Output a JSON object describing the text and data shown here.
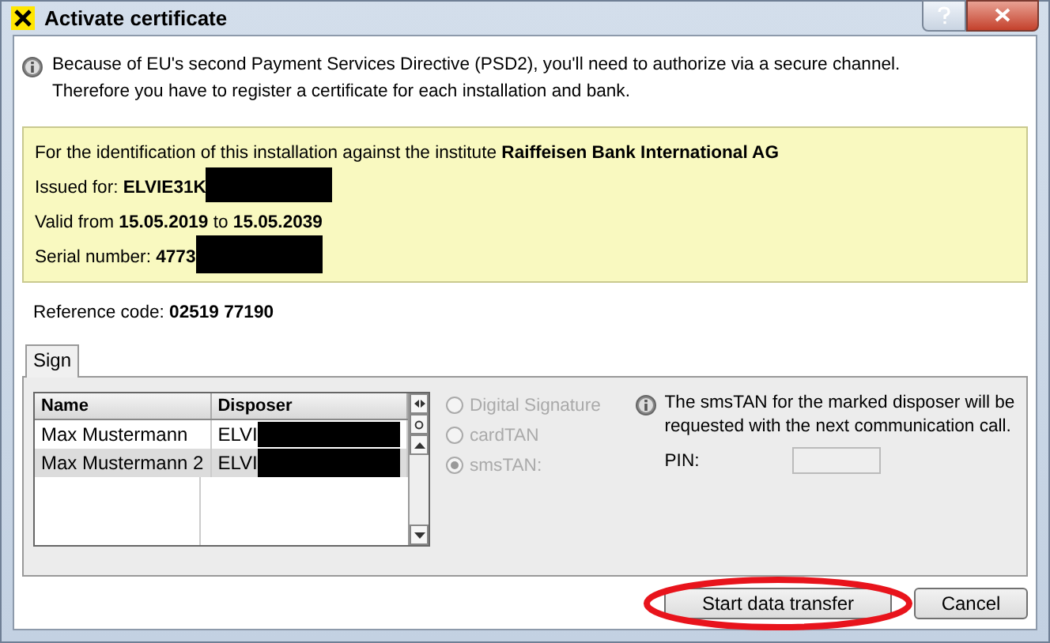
{
  "window": {
    "title": "Activate certificate"
  },
  "intro_lines": [
    "Because of EU's second Payment Services Directive (PSD2), you'll need to authorize via a secure channel.",
    "Therefore you have to register a certificate for each installation and bank."
  ],
  "certificate": [
    {
      "text": "For the identification of this installation against the institute **Raiffeisen Bank International AG**",
      "redacted": false
    },
    {
      "text": "Issued for: **ELVIE31K**",
      "redacted": true
    },
    {
      "text": "Valid from **15.05.2019** to **15.05.2039**",
      "redacted": false
    },
    {
      "text": "Serial number: **4773**",
      "redacted": true
    }
  ],
  "reference": "Reference code: **02519 77190**",
  "tabs": [
    {
      "label": "Sign",
      "selected": true
    }
  ],
  "table": {
    "columns": [
      "Name",
      "Disposer"
    ],
    "rows": [
      {
        "name": "Max Mustermann",
        "disposer": "ELVI",
        "redacted": true,
        "selected": false
      },
      {
        "name": "Max Mustermann 2",
        "disposer": "ELVI",
        "redacted": true,
        "selected": true
      }
    ]
  },
  "methods": [
    {
      "label": "Digital Signature",
      "checked": false,
      "disabled": true
    },
    {
      "label": "cardTAN",
      "checked": false,
      "disabled": true
    },
    {
      "label": "smsTAN:",
      "checked": true,
      "disabled": true
    }
  ],
  "note": "The smsTAN for the marked disposer will be requested with the next communication call.",
  "pin": {
    "label": "PIN:",
    "disabled": true
  },
  "buttons": [
    {
      "label": "Start data transfer",
      "highlighted": true
    },
    {
      "label": "Cancel",
      "highlighted": false
    }
  ]
}
